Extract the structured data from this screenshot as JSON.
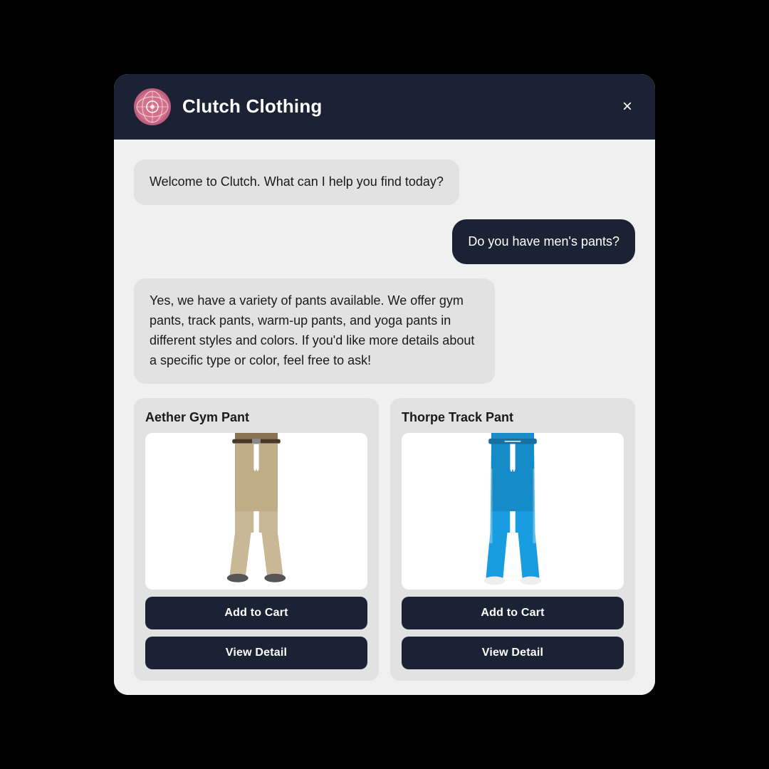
{
  "header": {
    "brand_name": "Clutch Clothing",
    "close_label": "×"
  },
  "messages": [
    {
      "id": "bot-welcome",
      "type": "bot",
      "text": "Welcome to Clutch. What can I help you find today?"
    },
    {
      "id": "user-query",
      "type": "user",
      "text": "Do you have men's pants?"
    },
    {
      "id": "bot-response",
      "type": "bot",
      "text": "Yes, we have a variety of pants available. We offer gym pants, track pants, warm-up pants, and yoga pants in different styles and colors. If you'd like more details about a specific type or color, feel free to ask!"
    }
  ],
  "products": [
    {
      "id": "product-1",
      "name": "Aether Gym Pant",
      "color": "khaki",
      "add_to_cart_label": "Add to Cart",
      "view_detail_label": "View Detail"
    },
    {
      "id": "product-2",
      "name": "Thorpe Track Pant",
      "color": "blue",
      "add_to_cart_label": "Add to Cart",
      "view_detail_label": "View Detail"
    }
  ]
}
